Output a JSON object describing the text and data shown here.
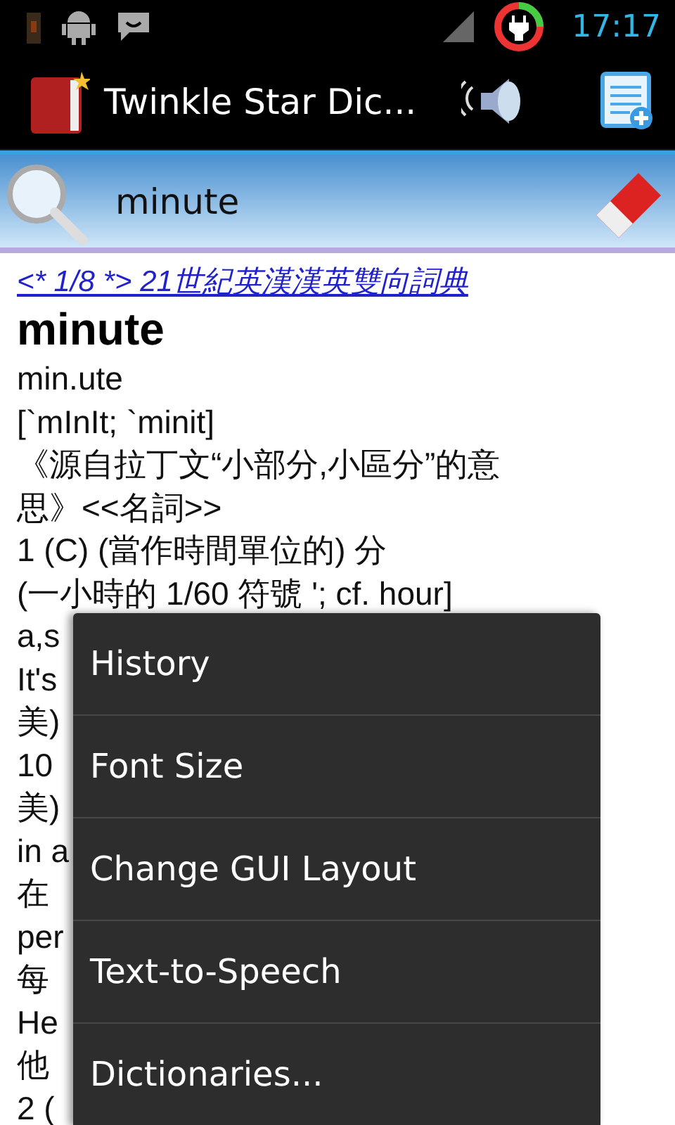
{
  "status_bar": {
    "time": "17:17"
  },
  "action_bar": {
    "title": "Twinkle Star Dic..."
  },
  "search": {
    "value": "minute"
  },
  "entry": {
    "source_link": "<* 1/8 *> 21世紀英漢漢英雙向詞典",
    "headword": "minute",
    "lines": [
      "min.ute",
      "[`mInIt; `minit]",
      "《源自拉丁文“小部分,小區分”的意思》<<名詞>>",
      "1 (C) (當作時間單位的) 分",
      "(一小時的 1/60 符號 '; cf. hour]",
      "a,s",
      "It's",
      "美)",
      "10",
      "美)",
      "in a",
      "在",
      "per",
      "每",
      "He",
      "他",
      "2 ("
    ]
  },
  "menu": [
    {
      "label": "History"
    },
    {
      "label": "Font Size"
    },
    {
      "label": "Change GUI Layout"
    },
    {
      "label": "Text-to-Speech"
    },
    {
      "label": "Dictionaries..."
    }
  ]
}
